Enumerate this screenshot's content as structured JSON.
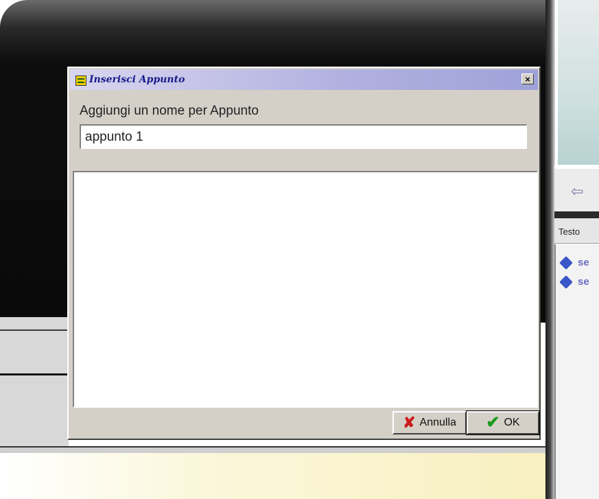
{
  "dialog": {
    "title": "Inserisci Appunto",
    "close_label": "×",
    "name_label": "Aggiungi un nome per Appunto",
    "name_value": "appunto 1",
    "buttons": {
      "cancel_label": "Annulla",
      "ok_label": "OK"
    }
  },
  "background_app": {
    "tab_label": "Testo",
    "list_items": [
      "se",
      "se"
    ]
  },
  "colors": {
    "titlebar_start": "#d8d6ee",
    "titlebar_end": "#9fa2d8",
    "title_text": "#1a1a8a",
    "dialog_face": "#d4d0c8",
    "cancel_icon": "#cc1a1a",
    "ok_icon": "#1a9a1a"
  },
  "icons": {
    "title": "dialog-app-icon",
    "close": "close-icon",
    "cancel": "red-x-icon",
    "ok": "green-check-icon",
    "back": "back-arrow-icon",
    "list_item": "diamond-icon"
  }
}
